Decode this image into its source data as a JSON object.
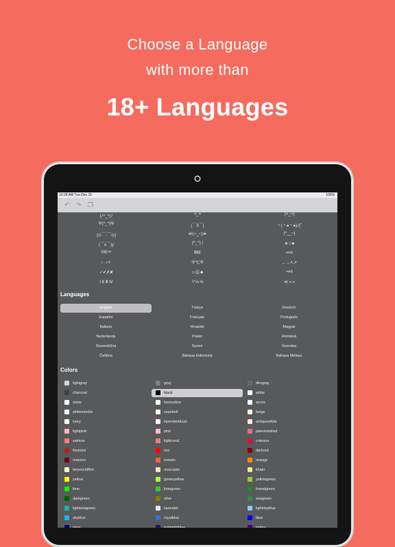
{
  "marketing": {
    "line1": "Choose a Language",
    "line2": "with more than",
    "line3": "18+ Languages"
  },
  "status": {
    "time": "10:28 AM   Tue Dec 15",
    "battery": "100%"
  },
  "toolbar": {
    "undo_icon": "undo-icon",
    "redo_icon": "redo-icon",
    "clipboard_icon": "clipboard-icon"
  },
  "emoticons": [
    "(ﾉ^_^)ﾉ",
    "=_=",
    "(=_=)",
    "Ψ(^_^)Ψ",
    "(￣3￣)",
    "ヽ(・●・●)ﾉ(˘",
    "(⊙￣-￣⊙)",
    "≪(~_~)≫",
    "(^__~)",
    "(￣o￣)y",
    "(^_^) /",
    "★☆♣",
    "©®™",
    "$€£",
    "∞≤≥",
    "♩♪♬",
    "℉℃℉",
    "←→↖↗",
    "✓✔✗✘",
    "☺😊☻",
    "≈≠≡",
    "Ⅰ Ⅱ Ⅲ Ⅳ",
    "⅟ ⅓ ⅔",
    "≪ « »"
  ],
  "languages_title": "Languages",
  "languages": [
    "English",
    "Türkçe",
    "Deutsch",
    "Español",
    "Français",
    "Português",
    "Italiano",
    "Hrvatski",
    "Magyar",
    "Nederlands",
    "Polski",
    "Română",
    "Slovenščina",
    "Suomi",
    "Svenska",
    "Čeština",
    "Bahasa Indonesia",
    "Bahasa Melayu"
  ],
  "selected_language": "English",
  "colors_title": "Colors",
  "colors": [
    {
      "name": "lightgray",
      "hex": "#d3d3d3"
    },
    {
      "name": "gray",
      "hex": "#808080"
    },
    {
      "name": "dimgray",
      "hex": "#696969"
    },
    {
      "name": "charcoal",
      "hex": "#36454f"
    },
    {
      "name": "black",
      "hex": "#000000"
    },
    {
      "name": "white",
      "hex": "#ffffff"
    },
    {
      "name": "snow",
      "hex": "#fffafa"
    },
    {
      "name": "honeydew",
      "hex": "#f0fff0"
    },
    {
      "name": "azure",
      "hex": "#f0ffff"
    },
    {
      "name": "whitesmoke",
      "hex": "#f5f5f5"
    },
    {
      "name": "seashell",
      "hex": "#fff5ee"
    },
    {
      "name": "beige",
      "hex": "#f5f5dc"
    },
    {
      "name": "ivory",
      "hex": "#fffff0"
    },
    {
      "name": "lavenderblush",
      "hex": "#fff0f5"
    },
    {
      "name": "antiquewhite",
      "hex": "#faebd7"
    },
    {
      "name": "lightpink",
      "hex": "#ffb6c1"
    },
    {
      "name": "pink",
      "hex": "#ffc0cb"
    },
    {
      "name": "palevioletred",
      "hex": "#db7093"
    },
    {
      "name": "salmon",
      "hex": "#fa8072"
    },
    {
      "name": "lightcoral",
      "hex": "#f08080"
    },
    {
      "name": "crimson",
      "hex": "#dc143c"
    },
    {
      "name": "firebrick",
      "hex": "#b22222"
    },
    {
      "name": "red",
      "hex": "#ff0000"
    },
    {
      "name": "darkred",
      "hex": "#8b0000"
    },
    {
      "name": "maroon",
      "hex": "#800000"
    },
    {
      "name": "tomato",
      "hex": "#ff6347"
    },
    {
      "name": "orange",
      "hex": "#ff8c00"
    },
    {
      "name": "lemonchiffon",
      "hex": "#fffacd"
    },
    {
      "name": "moccasin",
      "hex": "#ffe4b5"
    },
    {
      "name": "khaki",
      "hex": "#f0e68c"
    },
    {
      "name": "yellow",
      "hex": "#ffff00"
    },
    {
      "name": "greenyellow",
      "hex": "#adff2f"
    },
    {
      "name": "yellowgreen",
      "hex": "#9acd32"
    },
    {
      "name": "lime",
      "hex": "#00ff00"
    },
    {
      "name": "limegreen",
      "hex": "#32cd32"
    },
    {
      "name": "forestgreen",
      "hex": "#228b22"
    },
    {
      "name": "darkgreen",
      "hex": "#006400"
    },
    {
      "name": "olive",
      "hex": "#808000"
    },
    {
      "name": "seagreen",
      "hex": "#2e8b57"
    },
    {
      "name": "lightseagreen",
      "hex": "#20b2aa"
    },
    {
      "name": "lavender",
      "hex": "#e6e6fa"
    },
    {
      "name": "lightskyblue",
      "hex": "#87cefa"
    },
    {
      "name": "skyblue",
      "hex": "#00bfff"
    },
    {
      "name": "royalblue",
      "hex": "#4169e1"
    },
    {
      "name": "blue",
      "hex": "#0000ff"
    },
    {
      "name": "navy",
      "hex": "#000080"
    },
    {
      "name": "midnightblue",
      "hex": "#191970"
    },
    {
      "name": "indigo",
      "hex": "#4b0082"
    }
  ],
  "selected_color": "black",
  "theme": {
    "background": "#f56b5e",
    "panel": "#58595b",
    "toolbar": "#d3d4d8"
  }
}
